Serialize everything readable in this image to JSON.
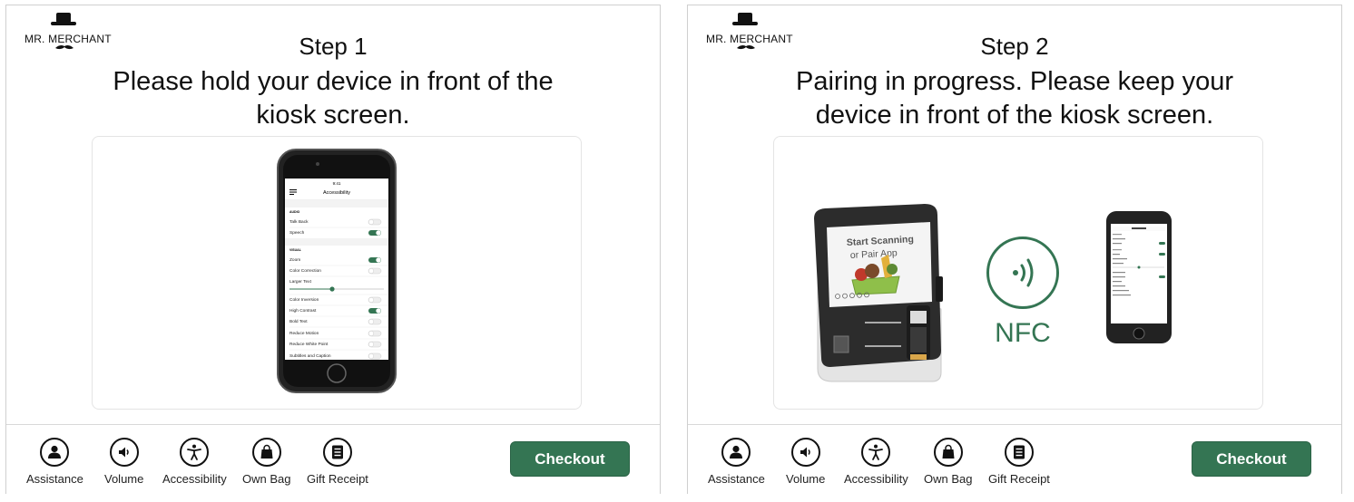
{
  "brand": {
    "name": "MR. MERCHANT"
  },
  "screens": [
    {
      "step": "Step 1",
      "instruction_line1": "Please hold your device in front of the",
      "instruction_line2": "kiosk screen.",
      "phone": {
        "time": "9:41",
        "title": "Accessibility",
        "sections": [
          {
            "header": "AUDIO",
            "items": [
              {
                "label": "Talk Back",
                "on": false
              },
              {
                "label": "Speech",
                "on": true
              }
            ]
          },
          {
            "header": "VISUAL",
            "items": [
              {
                "label": "Zoom",
                "on": true
              },
              {
                "label": "Color Correction",
                "on": false
              },
              {
                "label": "Larger Text",
                "slider": true
              },
              {
                "label": "Color Inversion",
                "on": false
              },
              {
                "label": "High Contrast",
                "on": true
              },
              {
                "label": "Bold Text",
                "on": false
              },
              {
                "label": "Reduce Motion",
                "on": false
              },
              {
                "label": "Reduce White Point",
                "on": false
              },
              {
                "label": "Subtitles and Caption",
                "on": false
              }
            ]
          }
        ]
      }
    },
    {
      "step": "Step 2",
      "instruction_line1": "Pairing in progress. Please keep your",
      "instruction_line2": "device in front of the kiosk screen.",
      "kiosk_screen_text_1": "Start Scanning",
      "kiosk_screen_text_2": "or Pair App",
      "nfc_label": "NFC"
    }
  ],
  "bottom_bar": {
    "items": [
      {
        "label": "Assistance",
        "icon": "person-icon"
      },
      {
        "label": "Volume",
        "icon": "speaker-icon"
      },
      {
        "label": "Accessibility",
        "icon": "accessibility-icon"
      },
      {
        "label": "Own Bag",
        "icon": "bag-icon"
      },
      {
        "label": "Gift Receipt",
        "icon": "receipt-icon"
      }
    ],
    "checkout_label": "Checkout"
  },
  "colors": {
    "accent": "#347553",
    "border": "#cfcfcf",
    "text": "#111111"
  }
}
